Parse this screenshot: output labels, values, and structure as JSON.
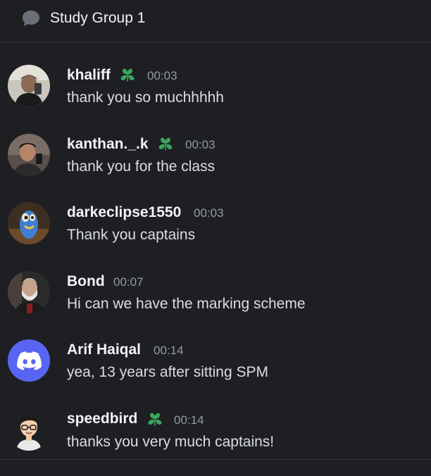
{
  "header": {
    "title": "Study Group 1",
    "icon": "thread-bubble-icon"
  },
  "messages": [
    {
      "username": "khaliff",
      "badge": "clover-badge-icon",
      "timestamp": "00:03",
      "text": "thank you so muchhhhh"
    },
    {
      "username": "kanthan._.k",
      "badge": "clover-badge-icon",
      "timestamp": "00:03",
      "text": "thank you for the class"
    },
    {
      "username": "darkeclipse1550",
      "timestamp": "00:03",
      "text": "Thank you captains"
    },
    {
      "username": "Bond",
      "timestamp": "00:07",
      "text": "Hi can we have the marking scheme"
    },
    {
      "username": "Arif Haiqal",
      "timestamp": "00:14",
      "text": "yea, 13 years after sitting SPM"
    },
    {
      "username": "speedbird",
      "badge": "clover-badge-icon",
      "timestamp": "00:14",
      "text": "thanks you very much captains!"
    }
  ],
  "colors": {
    "background": "#1e1f22",
    "username": "#f2f3f5",
    "message_text": "#dbdee1",
    "timestamp": "#949ba4",
    "badge_green": "#3ba55d",
    "discord_blurple": "#5865f2"
  }
}
